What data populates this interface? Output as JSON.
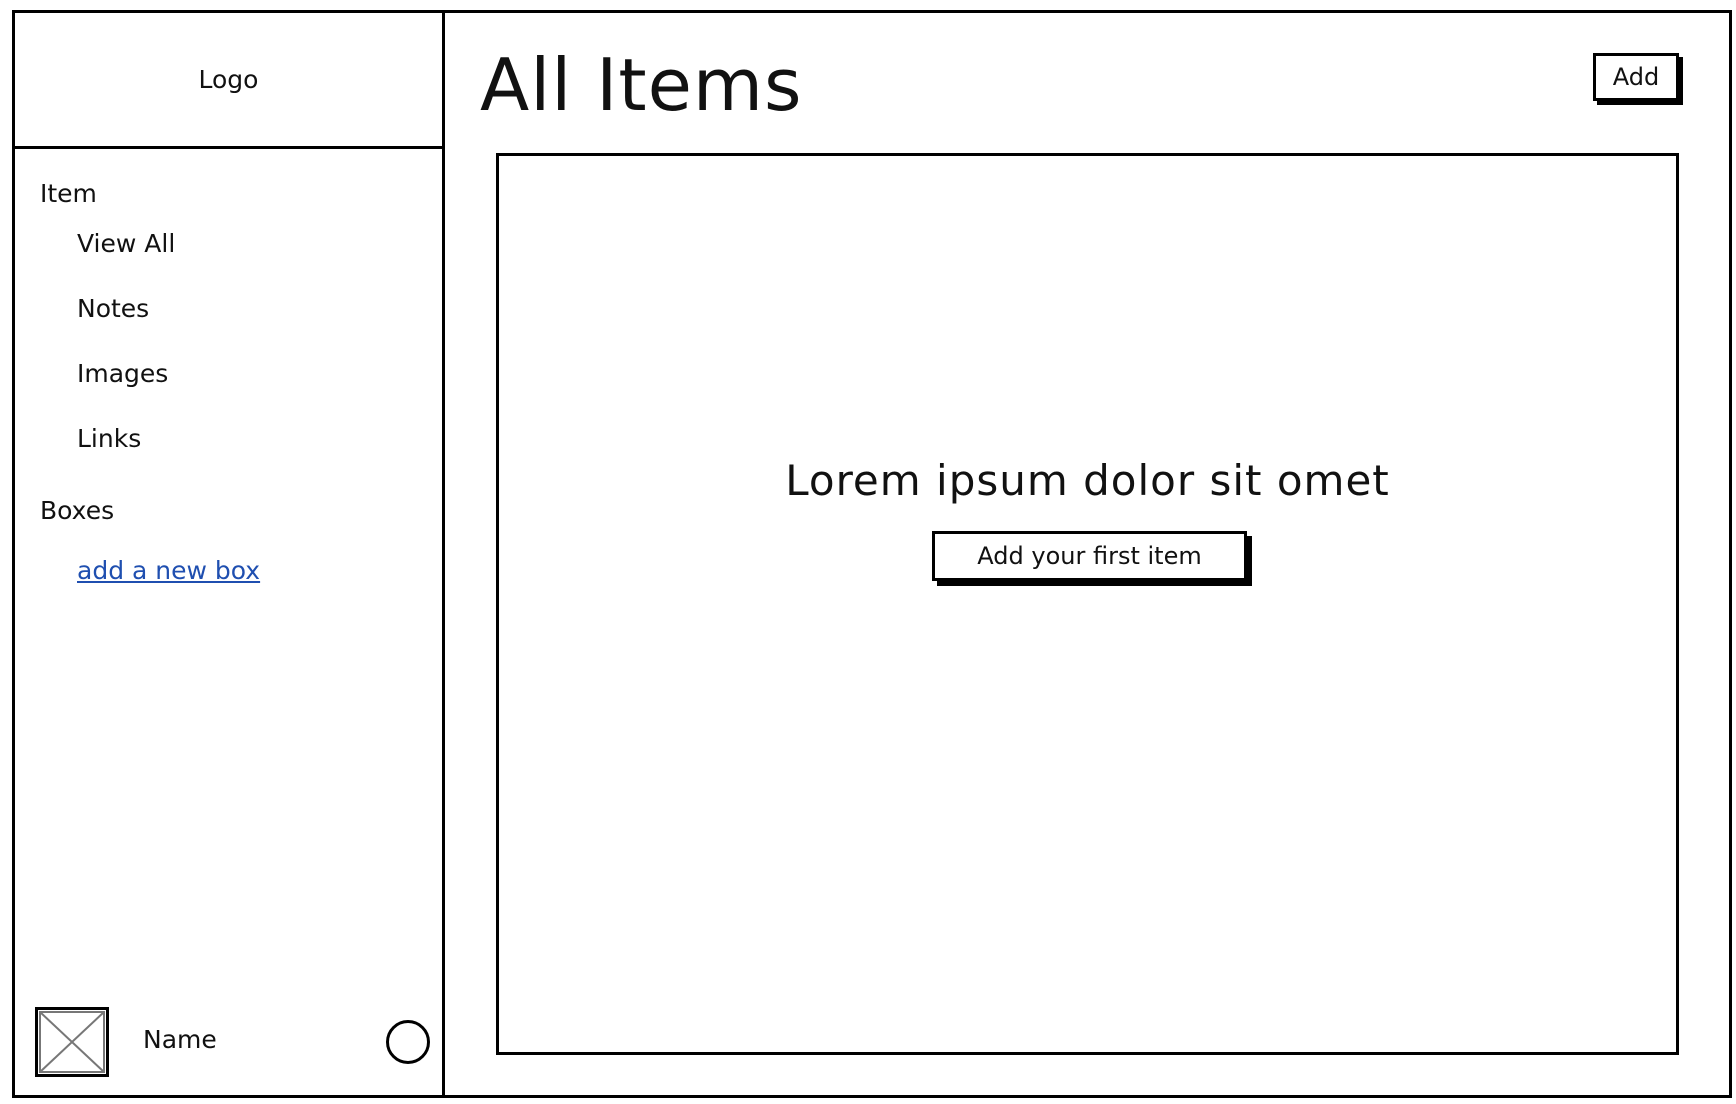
{
  "sidebar": {
    "logo": "Logo",
    "sections": [
      {
        "title": "Item",
        "items": [
          "View All",
          "Notes",
          "Images",
          "Links"
        ]
      },
      {
        "title": "Boxes",
        "link": "add a new box"
      }
    ],
    "user": {
      "name": "Name",
      "avatar_icon": "image-placeholder-icon",
      "status_icon": "circle-icon"
    }
  },
  "main": {
    "title": "All Items",
    "add_button": "Add",
    "empty_state": {
      "message": "Lorem ipsum dolor sit omet",
      "button": "Add your first item"
    }
  },
  "colors": {
    "link": "#1f4fb0",
    "border": "#000000",
    "background": "#ffffff"
  }
}
